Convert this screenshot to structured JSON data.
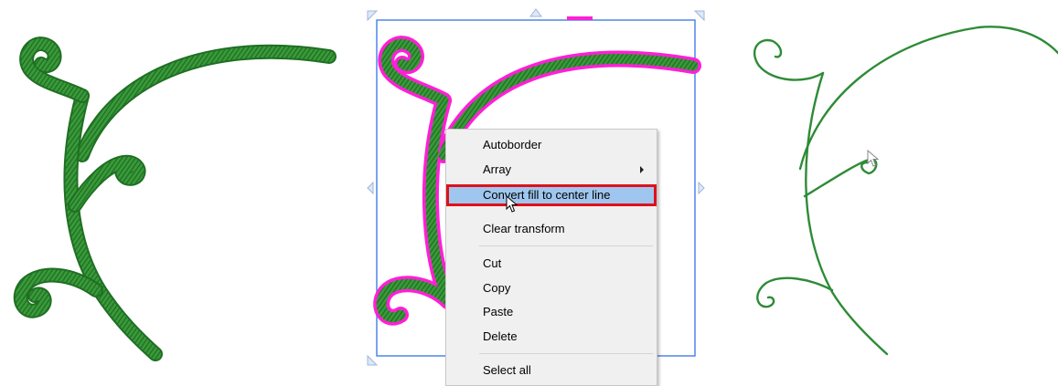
{
  "panels": {
    "left": {
      "label": ""
    },
    "middle": {
      "label": ""
    },
    "right": {
      "label": ""
    }
  },
  "context_menu": {
    "items": [
      {
        "label": "Autoborder",
        "has_submenu": false,
        "highlighted": false
      },
      {
        "label": "Array",
        "has_submenu": true,
        "highlighted": false
      },
      {
        "label": "Convert fill to center line",
        "has_submenu": false,
        "highlighted": true
      },
      {
        "label": "Clear transform",
        "has_submenu": false,
        "highlighted": false
      },
      {
        "label": "Cut",
        "has_submenu": false,
        "highlighted": false
      },
      {
        "label": "Copy",
        "has_submenu": false,
        "highlighted": false
      },
      {
        "label": "Paste",
        "has_submenu": false,
        "highlighted": false
      },
      {
        "label": "Delete",
        "has_submenu": false,
        "highlighted": false
      },
      {
        "label": "Select all",
        "has_submenu": false,
        "highlighted": false
      }
    ]
  },
  "colors": {
    "stitch_green": "#3a9a3a",
    "stitch_dark": "#1f6f23",
    "selection_magenta": "#ff1fd6",
    "bounding_blue": "#4f86ec",
    "menu_highlight": "#9fc6ee",
    "highlight_outline": "#e0101a",
    "centerline_green": "#2e8b36"
  },
  "icons": {
    "submenu": "chevron-right-icon",
    "cursor": "arrow-pointer-icon"
  }
}
